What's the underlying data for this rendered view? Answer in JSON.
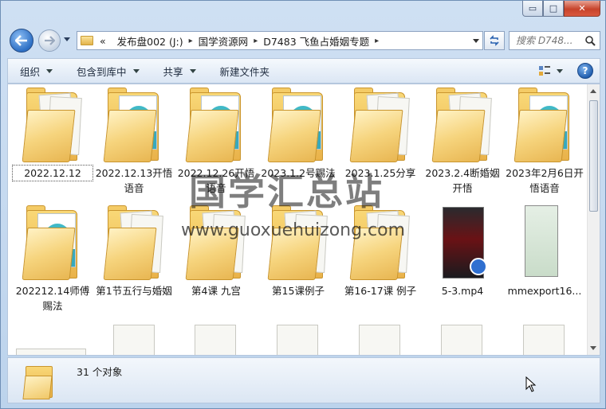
{
  "window": {
    "caption_buttons": {
      "minimize": "▭",
      "maximize": "□",
      "close": "✕"
    }
  },
  "address": {
    "chevron": "«",
    "crumbs": [
      "发布盘002 (J:)",
      "国学资源网",
      "D7483 飞鱼占婚姻专题"
    ],
    "separator": "▸"
  },
  "search": {
    "placeholder": "搜索 D748..."
  },
  "toolbar": {
    "organize": "组织",
    "include_library": "包含到库中",
    "share": "共享",
    "new_folder": "新建文件夹"
  },
  "items": [
    {
      "label": "2022.12.12",
      "kind": "folder-doc",
      "selected": true
    },
    {
      "label": "2022.12.13开悟语音",
      "kind": "folder-mp3"
    },
    {
      "label": "2022.12.26开悟语音",
      "kind": "folder-mp3"
    },
    {
      "label": "2023.1.2号赐法",
      "kind": "folder-mp3"
    },
    {
      "label": "2023.1.25分享",
      "kind": "folder-doc"
    },
    {
      "label": "2023.2.4断婚姻开悟",
      "kind": "folder-doc"
    },
    {
      "label": "2023年2月6日开悟语音",
      "kind": "folder-mp3"
    },
    {
      "label": "202212.14师傅赐法",
      "kind": "folder-mp3"
    },
    {
      "label": "第1节五行与婚姻",
      "kind": "folder-doc"
    },
    {
      "label": "第4课 九宫",
      "kind": "folder-doc"
    },
    {
      "label": "第15课例子",
      "kind": "folder-doc"
    },
    {
      "label": "第16-17课 例子",
      "kind": "folder-doc"
    },
    {
      "label": "5-3.mp4",
      "kind": "video"
    },
    {
      "label": "mmexport16...",
      "kind": "image"
    }
  ],
  "mp3_badge": "MP3",
  "watermark": {
    "cn": "国学汇总站",
    "en": "www.guoxuehuizong.com"
  },
  "details": {
    "count": "31 个对象"
  },
  "colors": {
    "folder": "#f6d47d",
    "mp3": "#37a9bd",
    "accent": "#2d6fc4"
  }
}
